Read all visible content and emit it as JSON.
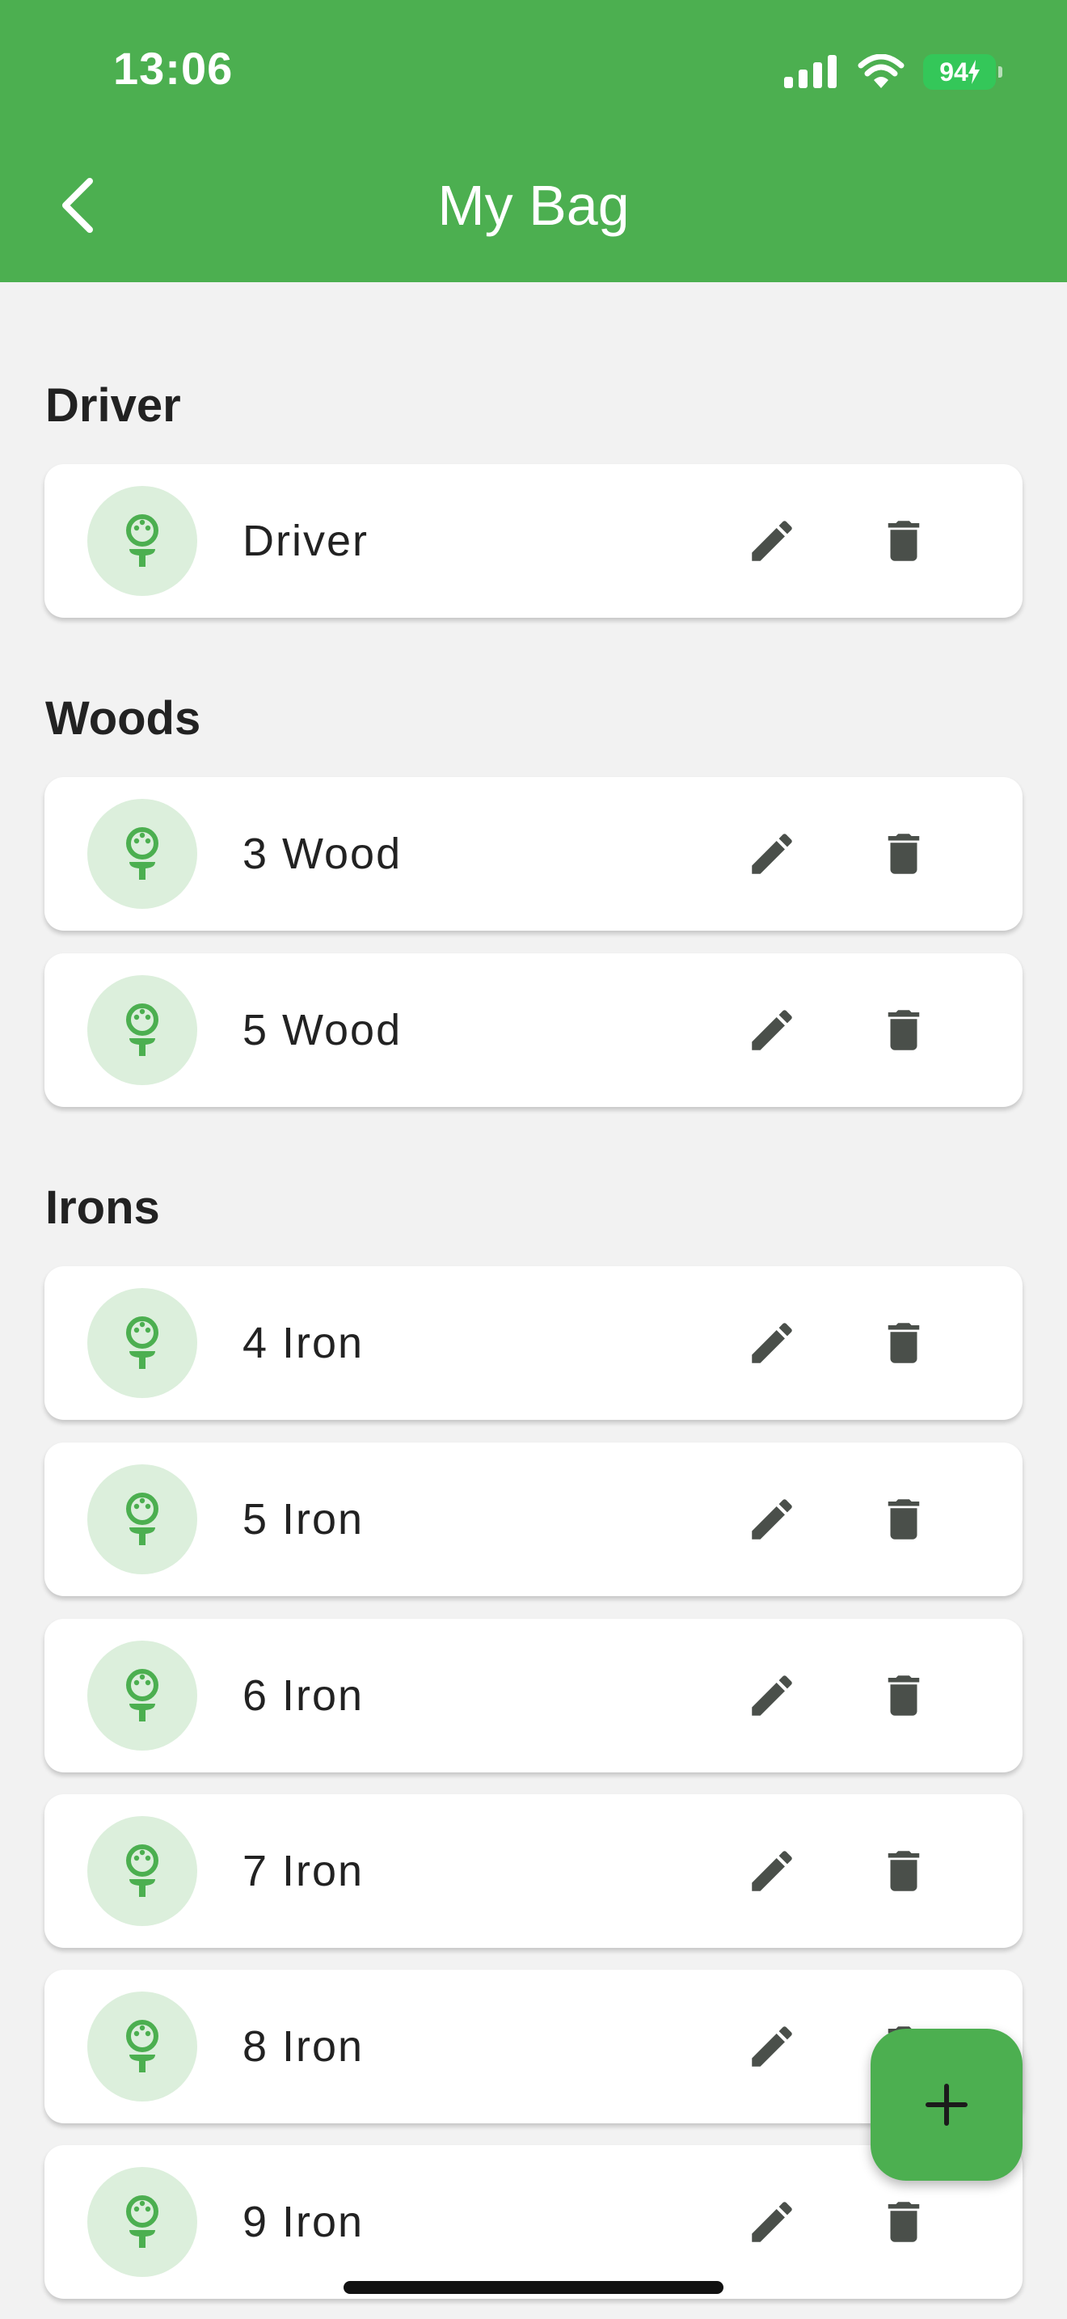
{
  "status_bar": {
    "time": "13:06",
    "battery": "94"
  },
  "header": {
    "title": "My Bag"
  },
  "sections": [
    {
      "title": "Driver",
      "clubs": [
        "Driver"
      ]
    },
    {
      "title": "Woods",
      "clubs": [
        "3 Wood",
        "5 Wood"
      ]
    },
    {
      "title": "Irons",
      "clubs": [
        "4 Iron",
        "5 Iron",
        "6 Iron",
        "7 Iron",
        "8 Iron",
        "9 Iron"
      ]
    }
  ],
  "icons": {
    "back": "chevron-left-icon",
    "club": "golf-ball-tee-icon",
    "edit": "pencil-icon",
    "delete": "trash-icon",
    "add": "plus-icon"
  },
  "colors": {
    "primary": "#4caf50",
    "avatar_bg": "#dcefdc",
    "action_icon": "#4a4f4a",
    "background": "#f2f2f2"
  }
}
